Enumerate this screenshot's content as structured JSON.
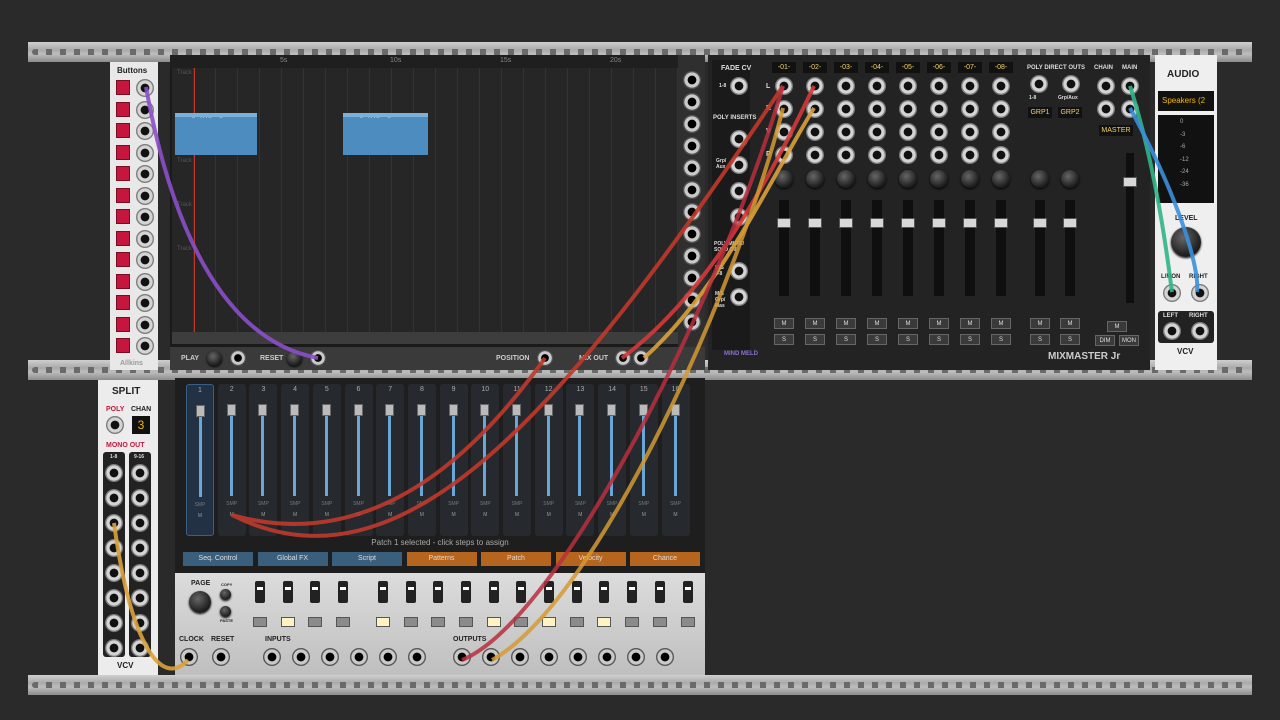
{
  "buttons": {
    "title": "Buttons",
    "footer": "Allkins"
  },
  "split": {
    "title": "SPLIT",
    "poly": "POLY",
    "chan": "CHAN",
    "chan_value": "3",
    "mono_out": "MONO OUT",
    "g1": "1-8",
    "g2": "9-16",
    "brand": "VCV"
  },
  "sequencer": {
    "ruler": [
      "5s",
      "10s",
      "15s",
      "20s"
    ],
    "tracks": [
      "Track",
      "Track",
      "Track",
      "Track",
      "Track"
    ],
    "clip_name": "breaks_drippp_125_harshbutter",
    "play": "PLAY",
    "reset": "RESET",
    "position": "POSITION",
    "mix_out": "MIX OUT"
  },
  "grid": {
    "steps": [
      "1",
      "2",
      "3",
      "4",
      "5",
      "6",
      "7",
      "8",
      "9",
      "10",
      "11",
      "12",
      "13",
      "14",
      "15",
      "16"
    ],
    "smp": "SMP",
    "m": "M",
    "status": "Patch 1 selected - click steps to assign",
    "tabs": [
      "Seq. Control",
      "Global FX",
      "Script",
      "Patterns",
      "Patch",
      "Velocity",
      "Chance"
    ],
    "page": "PAGE",
    "copy": "COPY",
    "paste": "PASTE",
    "clock": "CLOCK",
    "reset": "RESET",
    "inputs": "INPUTS",
    "outputs": "OUTPUTS"
  },
  "mixer": {
    "fade_cv": "FADE CV",
    "range": "1-8",
    "poly_inserts": "POLY INSERTS",
    "grp_aux": "Grp/ Aux",
    "poly_mute": "POLY MUTE/ SOLO CV",
    "ms": "M/S 1-8",
    "ms_grp": "M/S Grp/ Mas",
    "channels": [
      "-01-",
      "-02-",
      "-03-",
      "-04-",
      "-05-",
      "-06-",
      "-07-",
      "-08-"
    ],
    "poly_direct": "POLY DIRECT OUTS",
    "grp_aux2": "Grp/Aux",
    "grp1": "GRP1",
    "grp2": "GRP2",
    "chain": "CHAIN",
    "main": "MAIN",
    "master": "MASTER",
    "dim": "DIM",
    "mon": "MON",
    "m": "M",
    "s": "S",
    "brand": "MIXMASTER Jr",
    "maker": "MIND MELD",
    "row_l": "L",
    "row_r": "R",
    "row_v": "V",
    "row_p": "P"
  },
  "audio": {
    "title": "AUDIO",
    "device": "Speakers (2",
    "level": "LEVEL",
    "lmon": "L/MON",
    "right": "RIGHT",
    "left": "LEFT",
    "brand": "VCV",
    "db": [
      "0",
      "-3",
      "-6",
      "-12",
      "-24",
      "-36"
    ]
  }
}
